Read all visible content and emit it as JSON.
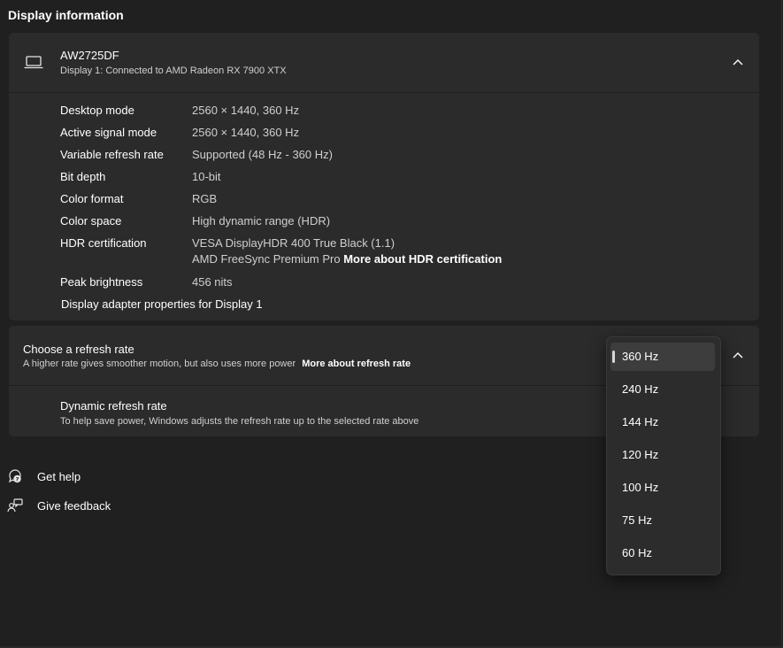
{
  "section_title": "Display information",
  "display": {
    "name": "AW2725DF",
    "subtitle": "Display 1: Connected to AMD Radeon RX 7900 XTX",
    "rows": [
      {
        "label": "Desktop mode",
        "value": "2560 × 1440, 360 Hz"
      },
      {
        "label": "Active signal mode",
        "value": "2560 × 1440, 360 Hz"
      },
      {
        "label": "Variable refresh rate",
        "value": "Supported (48 Hz - 360 Hz)"
      },
      {
        "label": "Bit depth",
        "value": "10-bit"
      },
      {
        "label": "Color format",
        "value": "RGB"
      },
      {
        "label": "Color space",
        "value": "High dynamic range (HDR)"
      },
      {
        "label": "HDR certification",
        "value": "VESA DisplayHDR 400 True Black (1.1)"
      },
      {
        "label": "Peak brightness",
        "value": "456 nits"
      }
    ],
    "hdr_cert_line2": "AMD FreeSync Premium Pro",
    "hdr_cert_link": "More about HDR certification",
    "adapter_link": "Display adapter properties for Display 1"
  },
  "refresh": {
    "title": "Choose a refresh rate",
    "subtitle": "A higher rate gives smoother motion, but also uses more power",
    "link": "More about refresh rate",
    "dynamic_title": "Dynamic refresh rate",
    "dynamic_subtitle": "To help save power, Windows adjusts the refresh rate up to the selected rate above",
    "options": [
      "360 Hz",
      "240 Hz",
      "144 Hz",
      "120 Hz",
      "100 Hz",
      "75 Hz",
      "60 Hz"
    ],
    "selected": "360 Hz"
  },
  "links": {
    "get_help": "Get help",
    "give_feedback": "Give feedback"
  },
  "icons": {
    "display": "laptop-icon",
    "collapse": "chevron-up-icon",
    "help": "help-icon",
    "feedback": "feedback-icon"
  },
  "colors": {
    "background": "#202020",
    "card": "#2b2b2b",
    "dropdown": "#2c2c2c"
  }
}
